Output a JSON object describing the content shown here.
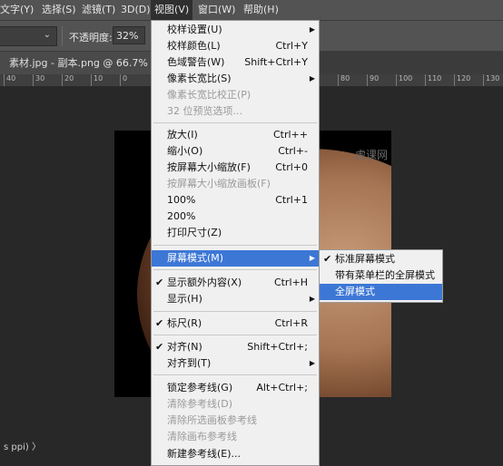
{
  "menubar": {
    "items": [
      {
        "label": "文字(Y)"
      },
      {
        "label": "选择(S)"
      },
      {
        "label": "滤镜(T)"
      },
      {
        "label": "3D(D)"
      },
      {
        "label": "视图(V)"
      },
      {
        "label": "窗口(W)"
      },
      {
        "label": "帮助(H)"
      }
    ]
  },
  "options": {
    "opacity_label": "不透明度:",
    "opacity_value": "32%"
  },
  "document": {
    "tab_title": "素材.jpg - 副本.png @ 66.7% (图"
  },
  "ruler": {
    "ticks": [
      "40",
      "30",
      "20",
      "10",
      "0",
      "80",
      "90",
      "100",
      "110",
      "120",
      "130"
    ]
  },
  "canvas": {
    "watermark": "虎课网"
  },
  "status": {
    "text": "s ppi)  〉"
  },
  "view_menu": {
    "items": [
      {
        "label": "校样设置(U)",
        "shortcut": "",
        "submenu": true
      },
      {
        "label": "校样颜色(L)",
        "shortcut": "Ctrl+Y"
      },
      {
        "label": "色域警告(W)",
        "shortcut": "Shift+Ctrl+Y"
      },
      {
        "label": "像素长宽比(S)",
        "shortcut": "",
        "submenu": true
      },
      {
        "label": "像素长宽比校正(P)",
        "shortcut": "",
        "disabled": true
      },
      {
        "label": "32 位预览选项...",
        "shortcut": "",
        "disabled": true
      },
      {
        "label": "放大(I)",
        "shortcut": "Ctrl++"
      },
      {
        "label": "缩小(O)",
        "shortcut": "Ctrl+-"
      },
      {
        "label": "按屏幕大小缩放(F)",
        "shortcut": "Ctrl+0"
      },
      {
        "label": "按屏幕大小缩放画板(F)",
        "shortcut": "",
        "disabled": true
      },
      {
        "label": "100%",
        "shortcut": "Ctrl+1"
      },
      {
        "label": "200%",
        "shortcut": ""
      },
      {
        "label": "打印尺寸(Z)",
        "shortcut": ""
      },
      {
        "label": "屏幕模式(M)",
        "shortcut": "",
        "submenu": true,
        "highlighted": true
      },
      {
        "label": "显示额外内容(X)",
        "shortcut": "Ctrl+H",
        "checked": true
      },
      {
        "label": "显示(H)",
        "shortcut": "",
        "submenu": true
      },
      {
        "label": "标尺(R)",
        "shortcut": "Ctrl+R",
        "checked": true
      },
      {
        "label": "对齐(N)",
        "shortcut": "Shift+Ctrl+;",
        "checked": true
      },
      {
        "label": "对齐到(T)",
        "shortcut": "",
        "submenu": true
      },
      {
        "label": "锁定参考线(G)",
        "shortcut": "Alt+Ctrl+;"
      },
      {
        "label": "清除参考线(D)",
        "shortcut": "",
        "disabled": true
      },
      {
        "label": "清除所选画板参考线",
        "shortcut": "",
        "disabled": true
      },
      {
        "label": "清除画布参考线",
        "shortcut": "",
        "disabled": true
      },
      {
        "label": "新建参考线(E)...",
        "shortcut": ""
      }
    ]
  },
  "screen_mode_submenu": {
    "items": [
      {
        "label": "标准屏幕模式",
        "checked": true
      },
      {
        "label": "带有菜单栏的全屏模式"
      },
      {
        "label": "全屏模式",
        "highlighted": true
      }
    ]
  },
  "colors": {
    "menu_highlight": "#3d77d6",
    "menu_bg": "#f0f0f0",
    "app_bg": "#282828"
  }
}
